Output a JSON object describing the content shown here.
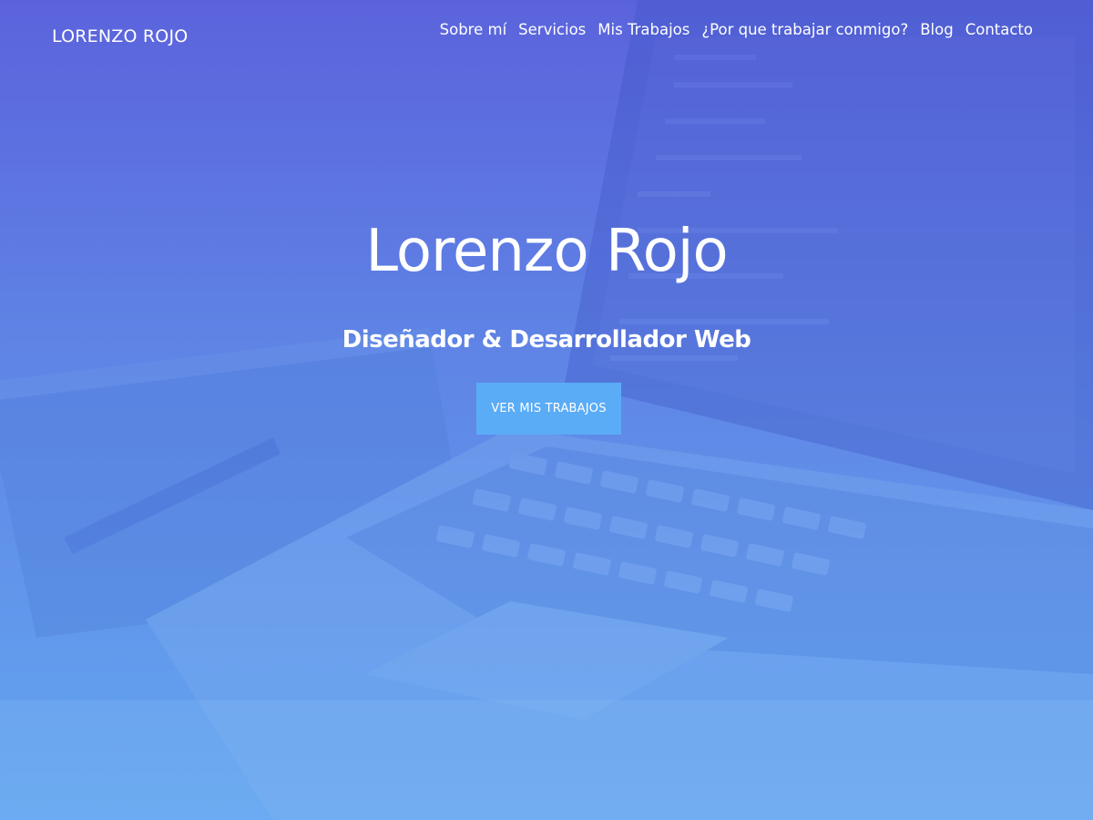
{
  "brand": {
    "name": "LORENZO ROJO"
  },
  "nav": {
    "items": [
      {
        "label": "Sobre mí"
      },
      {
        "label": "Servicios"
      },
      {
        "label": "Mis Trabajos"
      },
      {
        "label": "¿Por que trabajar conmigo?"
      },
      {
        "label": "Blog"
      },
      {
        "label": "Contacto"
      }
    ]
  },
  "hero": {
    "title": "Lorenzo Rojo",
    "subtitle": "Diseñador & Desarrollador Web",
    "cta_label": "VER MIS TRABAJOS",
    "background_image": "laptop-desk-photo",
    "overlay_colors": [
      "#5b63dc",
      "#63a6f0"
    ],
    "cta_color": "#5aacf6"
  }
}
